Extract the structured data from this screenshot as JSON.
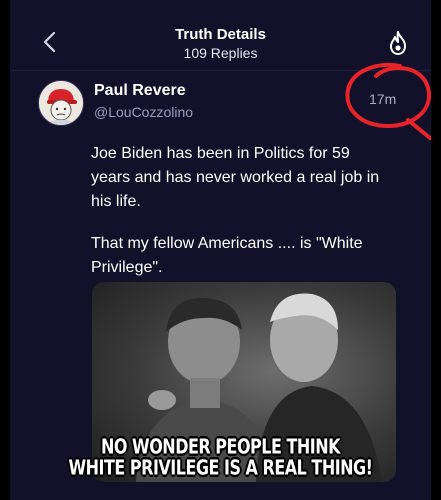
{
  "header": {
    "title": "Truth Details",
    "subtitle": "109 Replies",
    "back_icon": "chevron-left-icon",
    "action_icon": "flame-icon"
  },
  "post": {
    "author_name": "Paul Revere",
    "author_handle": "@LouCozzolino",
    "time_ago": "17m",
    "paragraphs": [
      "Joe Biden has been in Politics for 59 years and has never worked a real job in his life.",
      "That my fellow Americans .... is \"White Privilege\"."
    ],
    "image": {
      "caption_lines": [
        "NO WONDER PEOPLE THINK",
        "WHITE PRIVILEGE IS A REAL THING!"
      ]
    }
  },
  "colors": {
    "background": "#13102a",
    "text_primary": "#ffffff",
    "text_secondary": "#9f9ab8",
    "annotation_red": "#e8232a"
  }
}
